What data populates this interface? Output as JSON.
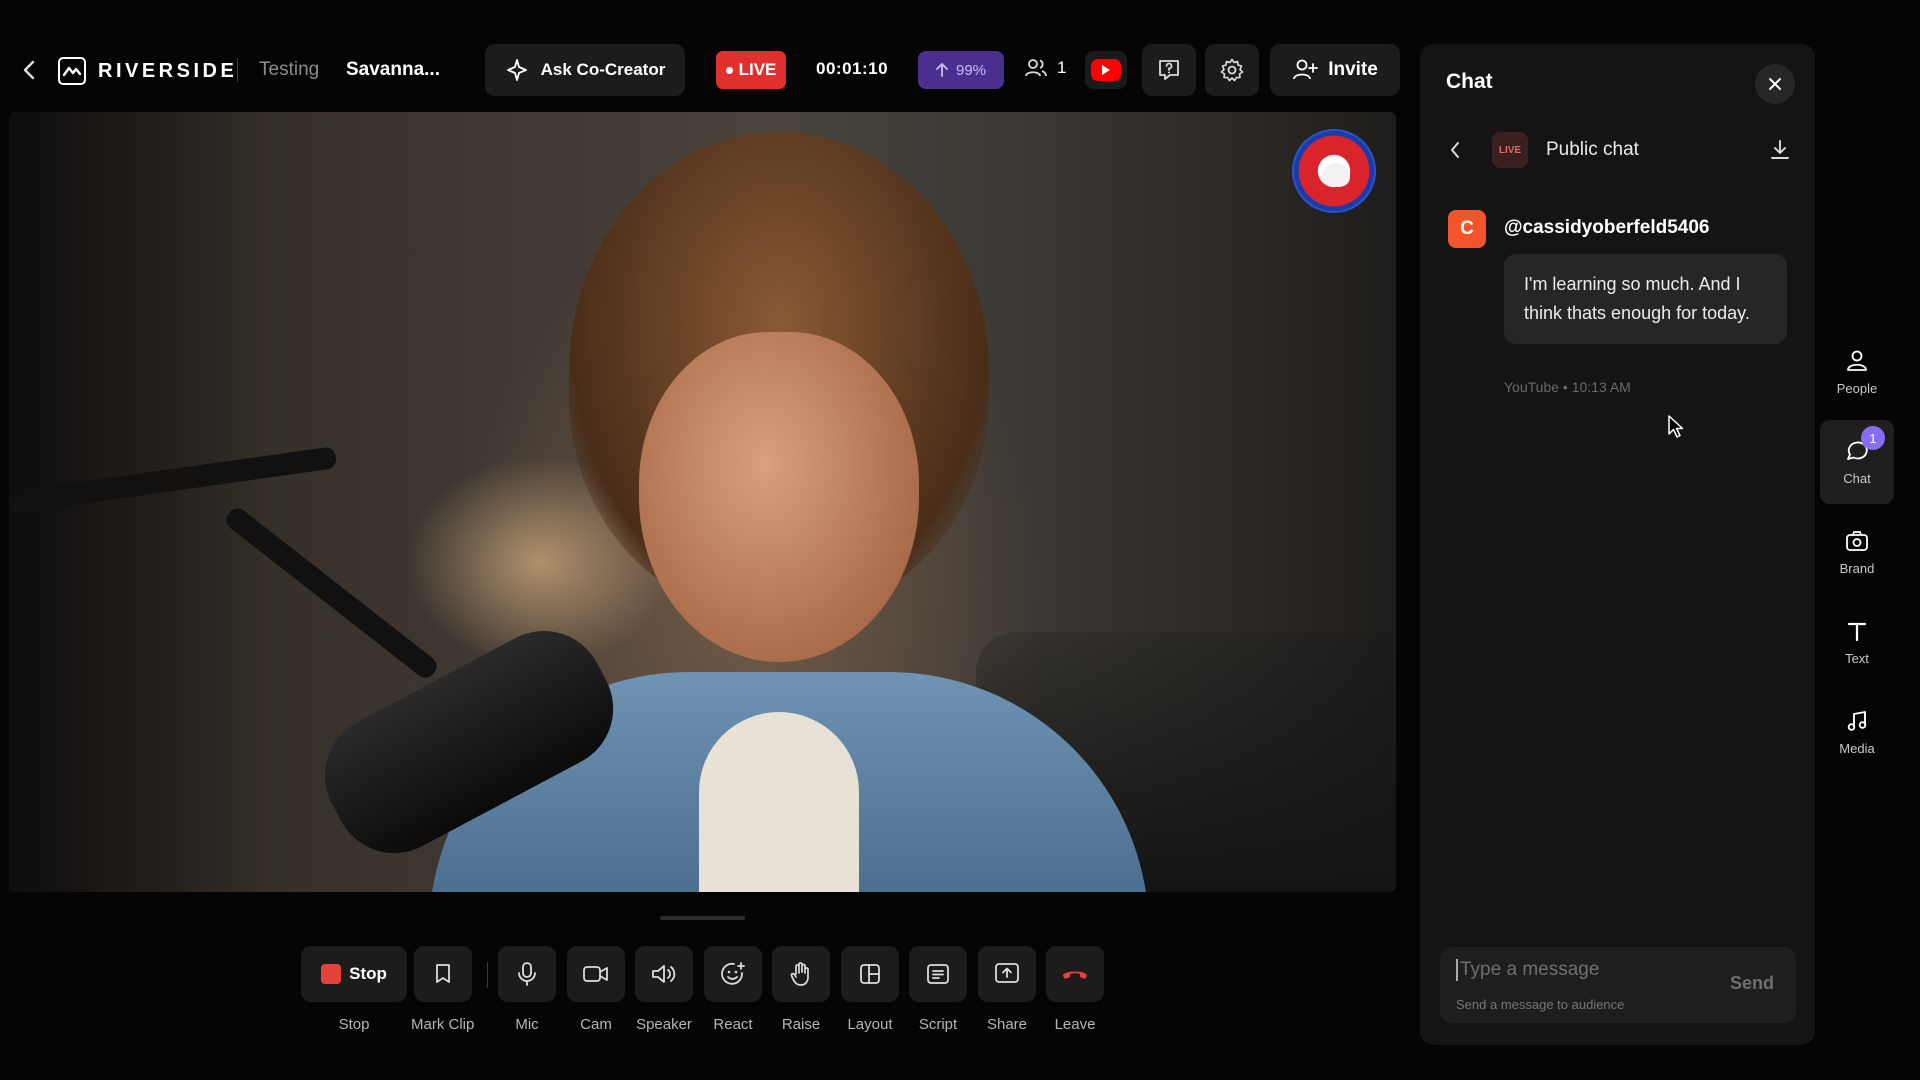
{
  "header": {
    "brand": "RIVERSIDE",
    "breadcrumbs": [
      "Testing",
      "Savanna..."
    ],
    "ask_label": "Ask Co-Creator",
    "live_label": "LIVE",
    "timer": "00:01:10",
    "upload_percent": "99%",
    "participants": "1",
    "invite_label": "Invite",
    "icons": [
      "back-icon",
      "ask-sparkle-icon",
      "upload-arrow-icon",
      "people-icon",
      "youtube-icon",
      "help-chat-icon",
      "gear-icon",
      "add-user-icon"
    ]
  },
  "controls": [
    {
      "label": "Stop",
      "button_text": "Stop",
      "icon": "stop-square-icon"
    },
    {
      "label": "Mark Clip",
      "icon": "bookmark-icon"
    },
    {
      "label": "Mic",
      "icon": "mic-icon"
    },
    {
      "label": "Cam",
      "icon": "camera-icon"
    },
    {
      "label": "Speaker",
      "icon": "speaker-icon"
    },
    {
      "label": "React",
      "icon": "emoji-icon"
    },
    {
      "label": "Raise",
      "icon": "hand-icon"
    },
    {
      "label": "Layout",
      "icon": "layout-icon"
    },
    {
      "label": "Script",
      "icon": "script-icon"
    },
    {
      "label": "Share",
      "icon": "share-screen-icon"
    },
    {
      "label": "Leave",
      "icon": "hang-up-icon"
    }
  ],
  "chat": {
    "title": "Chat",
    "sub_live": "LIVE",
    "sub_title": "Public chat",
    "messages": [
      {
        "avatar_letter": "C",
        "user": "@cassidyoberfeld5406",
        "text": "I'm learning so much. And I think thats enough for today.",
        "meta": "YouTube • 10:13 AM"
      }
    ],
    "input_placeholder": "Type a message",
    "input_hint": "Send a message to audience",
    "send_label": "Send"
  },
  "rail": [
    {
      "label": "People",
      "icon": "people-icon"
    },
    {
      "label": "Chat",
      "icon": "chat-icon",
      "badge": "1",
      "active": true
    },
    {
      "label": "Brand",
      "icon": "brand-icon"
    },
    {
      "label": "Text",
      "icon": "text-icon"
    },
    {
      "label": "Media",
      "icon": "music-note-icon"
    }
  ],
  "colors": {
    "live_red": "#e1312f",
    "upload_purple": "#4a2f8e",
    "avatar_orange": "#f2552c",
    "badge_purple": "#8a6cf0",
    "stop_red": "#e5433a"
  }
}
